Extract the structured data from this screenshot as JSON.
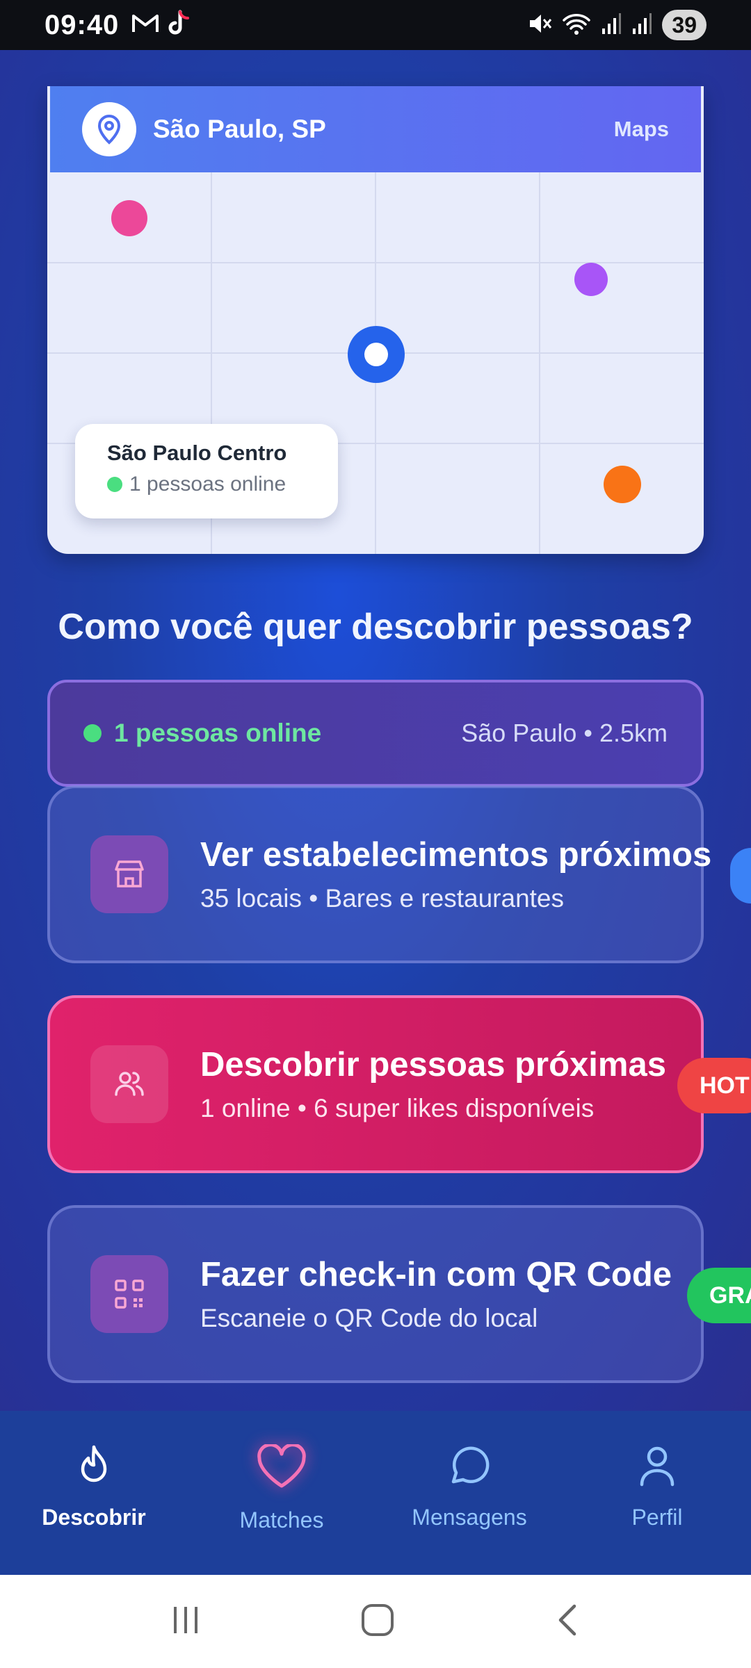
{
  "status_bar": {
    "time": "09:40",
    "battery": "39",
    "icons": [
      "gmail-icon",
      "tiktok-icon",
      "mute-icon",
      "wifi-icon",
      "signal-icon",
      "signal-icon"
    ]
  },
  "map": {
    "city": "São Paulo, SP",
    "maps_link": "Maps",
    "popup_title": "São Paulo Centro",
    "popup_subtitle": "1 pessoas online",
    "dot_colors": [
      "#ec4899",
      "#a855f7",
      "#2563eb",
      "#f97316"
    ]
  },
  "section_title": "Como você quer descobrir pessoas?",
  "online_bar": {
    "online_text": "1 pessoas online",
    "location_text": "São Paulo • 2.5km"
  },
  "cards": [
    {
      "title": "Ver estabelecimentos próximos",
      "subtitle": "35 locais • Bares e restaurantes",
      "icon": "store-icon"
    },
    {
      "title": "Descobrir pessoas próximas",
      "subtitle": "1 online • 6 super likes disponíveis",
      "icon": "users-icon",
      "badge": "HOT"
    },
    {
      "title": "Fazer check-in com QR Code",
      "subtitle": "Escaneie o QR Code do local",
      "icon": "qr-code-icon",
      "badge": "GRÁ"
    }
  ],
  "bottom_nav": [
    {
      "label": "Descobrir",
      "icon": "flame-icon",
      "active": true
    },
    {
      "label": "Matches",
      "icon": "heart-icon",
      "active": false
    },
    {
      "label": "Mensagens",
      "icon": "chat-icon",
      "active": false
    },
    {
      "label": "Perfil",
      "icon": "user-icon",
      "active": false
    }
  ],
  "colors": {
    "accent_pink": "#e0226b",
    "online_green": "#4ade80",
    "hot_badge": "#ef4444",
    "free_badge": "#22c55e"
  }
}
